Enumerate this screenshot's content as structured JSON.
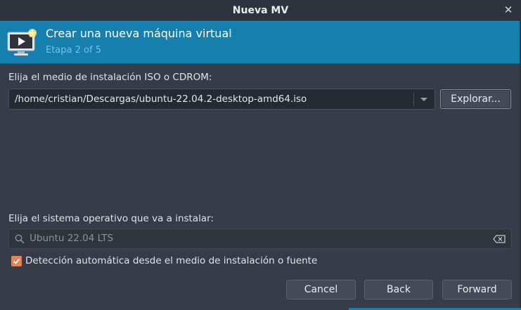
{
  "window": {
    "title": "Nueva MV"
  },
  "banner": {
    "title": "Crear una nueva máquina virtual",
    "subtitle": "Etapa 2 of 5",
    "icon": "new-vm-monitor-icon"
  },
  "iso": {
    "label": "Elija el medio de instalación ISO o CDROM:",
    "value": "/home/cristian/Descargas/ubuntu-22.04.2-desktop-amd64.iso",
    "browse_label": "Explorar..."
  },
  "os": {
    "label": "Elija el sistema operativo que va a instalar:",
    "search_placeholder": "Ubuntu 22.04 LTS",
    "autodetect_label": "Detección automática desde el medio de instalación o fuente",
    "autodetect_checked": true
  },
  "footer": {
    "cancel_label": "Cancel",
    "back_label": "Back",
    "forward_label": "Forward"
  },
  "colors": {
    "banner": "#157fad",
    "checkbox": "#e0845a",
    "background": "#373c48"
  }
}
